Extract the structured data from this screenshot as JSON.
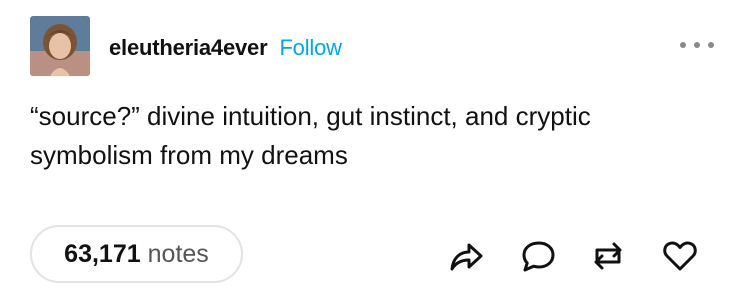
{
  "post": {
    "username": "eleutheria4ever",
    "follow_label": "Follow",
    "body": "“source?” divine intuition, gut instinct, and cryptic symbolism from my dreams",
    "notes_count": "63,171",
    "notes_label": "notes"
  },
  "icons": {
    "avatar": "user-avatar-photo",
    "more": "more-options-icon",
    "share": "share-icon",
    "reply": "reply-icon",
    "reblog": "reblog-icon",
    "like": "heart-icon"
  },
  "colors": {
    "accent": "#00a7e6",
    "text": "#111111",
    "muted": "#555555"
  }
}
